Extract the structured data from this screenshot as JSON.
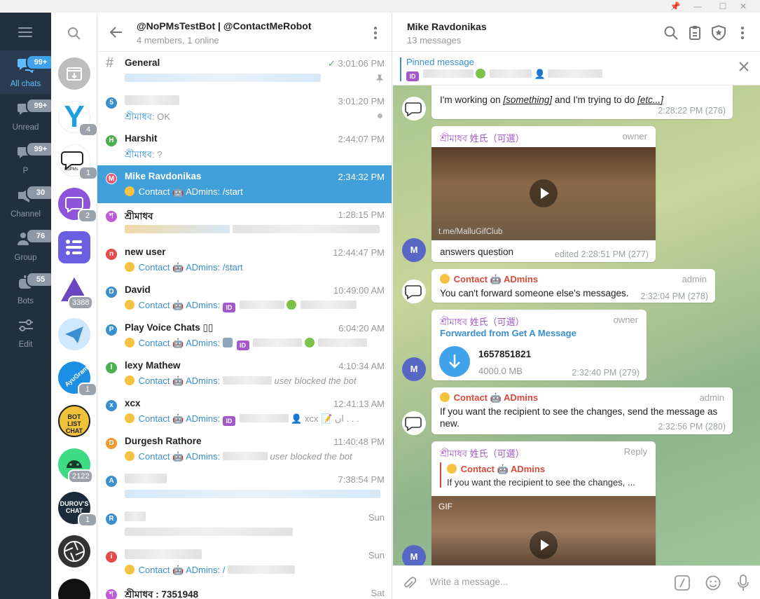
{
  "window": {
    "pin": "📌",
    "minimize": "—",
    "maximize": "☐",
    "close": "✕"
  },
  "folders": [
    {
      "label": "All chats",
      "badge": "99+",
      "active": true,
      "icon": "chats-icon"
    },
    {
      "label": "Unread",
      "badge": "99+",
      "icon": "unread-icon"
    },
    {
      "label": "P",
      "badge": "99+",
      "icon": "folder-p-icon"
    },
    {
      "label": "Channel",
      "badge": "30",
      "icon": "channel-icon"
    },
    {
      "label": "Group",
      "badge": "76",
      "icon": "group-icon"
    },
    {
      "label": "Bots",
      "badge": "55",
      "icon": "bots-icon"
    },
    {
      "label": "Edit",
      "icon": "edit-folders-icon"
    }
  ],
  "avatars": [
    {
      "color": "#bdbdbd",
      "badge": "",
      "icon": "archive-icon"
    },
    {
      "color": "#ffffff",
      "badge": "4",
      "letter": "Y",
      "letter_color": "#1e9fe0"
    },
    {
      "color": "#ffffff",
      "badge": "1",
      "letter": "NoPMs"
    },
    {
      "color": "#8e54d9",
      "badge": "2"
    },
    {
      "color": "#6a5fe0",
      "badge": ""
    },
    {
      "color": "#6b46c1",
      "badge": "3388"
    },
    {
      "color": "#cfe8fb",
      "badge": ""
    },
    {
      "color": "#1b8fe4",
      "badge": "1",
      "letter": "AyuGram"
    },
    {
      "color": "#f0c23a",
      "badge": "",
      "letter": "BOT LIST CHAT"
    },
    {
      "color": "#3ddc84",
      "badge": "2122"
    },
    {
      "color": "#1c2b3c",
      "badge": "1",
      "letter": "DUROV'S CHAT"
    },
    {
      "color": "#333333",
      "badge": ""
    },
    {
      "color": "#111111",
      "badge": ""
    }
  ],
  "chat_list": {
    "title": "@NoPMsTestBot | @ContactMeRobot",
    "subtitle": "4 members, 1 online",
    "rows": [
      {
        "mark": "#",
        "name": "General",
        "time": "3:01:06 PM",
        "mark_color": ""
      },
      {
        "mark": "5",
        "name": "",
        "time": "3:01:20 PM",
        "sender": "শ্রীমাধব",
        "text": ": OK",
        "mark_color": "#3a8fd0"
      },
      {
        "mark": "H",
        "name": "Harshit",
        "time": "2:44:07 PM",
        "sender": "শ্রীমাধব",
        "text": ": ?",
        "mark_color": "#4caf50"
      },
      {
        "mark": "M",
        "name": "Mike Ravdonikas",
        "time": "2:34:32 PM",
        "text": "Contact 🤖 ADmins: /start",
        "mark_color": "#e95a7a"
      },
      {
        "mark": "শ",
        "name": "শ্রীমাধব",
        "time": "1:28:15 PM",
        "mark_color": "#c05ad6"
      },
      {
        "mark": "n",
        "name": "new user",
        "time": "12:44:47 PM",
        "text": "Contact 🤖 ADmins: /start",
        "mark_color": "#e64a4a"
      },
      {
        "mark": "D",
        "name": "David",
        "time": "10:49:00 AM",
        "text": "Contact 🤖 ADmins:",
        "mark_color": "#3a8fd0"
      },
      {
        "mark": "P",
        "name": "Play Voice Chats ▯▯",
        "time": "6:04:20 AM",
        "text": "Contact 🤖 ADmins:",
        "mark_color": "#3a8fd0"
      },
      {
        "mark": "l",
        "name": "lexy Mathew",
        "time": "4:10:34 AM",
        "text": "Contact 🤖 ADmins:",
        "extra": "user blocked the bot",
        "mark_color": "#4caf50"
      },
      {
        "mark": "x",
        "name": "xcx",
        "time": "12:41:13 AM",
        "text": "Contact 🤖 ADmins:",
        "extra": "👤 xcx 📝 ان . . .",
        "mark_color": "#3a8fd0"
      },
      {
        "mark": "D",
        "name": "Durgesh Rathore",
        "time": "11:40:48 PM",
        "text": "Contact 🤖 ADmins:",
        "extra": "user blocked the bot",
        "mark_color": "#f29a2e"
      },
      {
        "mark": "A",
        "name": "",
        "time": "7:38:54 PM",
        "mark_color": "#3a8fd0"
      },
      {
        "mark": "R",
        "name": "",
        "time": "Sun",
        "mark_color": "#3a8fd0"
      },
      {
        "mark": "i",
        "name": "",
        "time": "Sun",
        "text": "Contact 🤖 ADmins: /",
        "mark_color": "#e64a4a"
      },
      {
        "mark": "শ",
        "name": "শ্রীমাধব : 7351948",
        "time": "Sat",
        "mark_color": "#c05ad6"
      }
    ]
  },
  "conversation": {
    "title": "Mike Ravdonikas",
    "subtitle": "13 messages",
    "pinned_label": "Pinned message",
    "compose_placeholder": "Write a message...",
    "messages": {
      "m276": {
        "pre": "I'm working on ",
        "em1": "[something]",
        "mid": " and I'm trying to do ",
        "em2": "[etc...]",
        "time": "2:28:22 PM (276)"
      },
      "m277": {
        "sender": "শ্রীমাধব 姓氏（可選）",
        "role": "owner",
        "watermark": "t.me/MalluGifClub",
        "text": "answers question",
        "time": "edited 2:28:51 PM (277)"
      },
      "m278": {
        "sender": "Contact 🤖 ADmins",
        "role": "admin",
        "text": "You can't forward someone else's messages.",
        "time": "2:32:04 PM (278)"
      },
      "m279": {
        "sender": "শ্রীমাধব 姓氏（可選）",
        "role": "owner",
        "forward": "Forwarded from Get A Message",
        "file_name": "1657851821",
        "file_size": "4000.0 MB",
        "time": "2:32:40 PM (279)"
      },
      "m280": {
        "sender": "Contact 🤖 ADmins",
        "role": "admin",
        "text": "If you want the recipient to see the changes, send the message as new.",
        "time": "2:32:56 PM (280)"
      },
      "m281": {
        "sender": "শ্রীমাধব 姓氏（可選）",
        "role": "Reply",
        "reply_sender": "Contact 🤖 ADmins",
        "reply_text": "If you want the recipient to see the changes, ...",
        "gif_label": "GIF"
      }
    }
  },
  "colors": {
    "accent": "#419fd9",
    "sidebar": "#222f3f",
    "owner_name": "#a359c9",
    "admin_name": "#d74a3a"
  }
}
